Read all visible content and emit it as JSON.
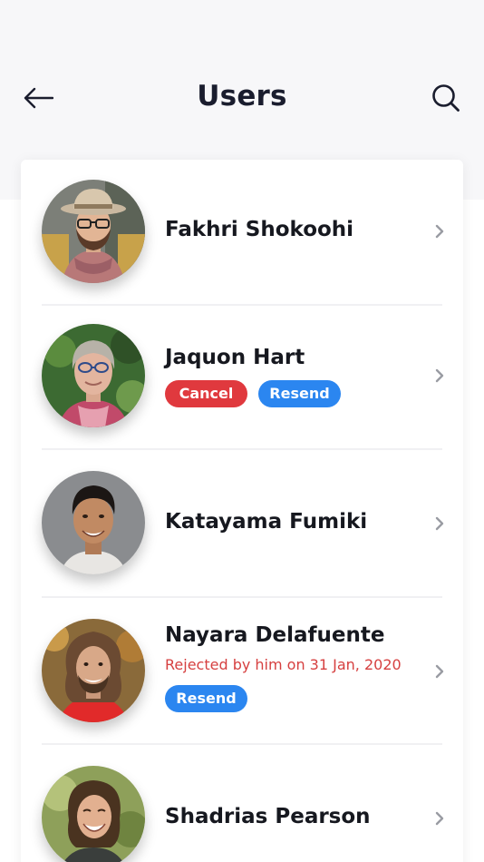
{
  "header": {
    "title": "Users",
    "back_icon": "arrow-left-icon",
    "search_icon": "search-icon"
  },
  "colors": {
    "header_background": "#f7f7f9",
    "cancel": "#e0393e",
    "resend": "#2b86f0",
    "rejected_text": "#d64040",
    "name_text": "#16181f"
  },
  "users": [
    {
      "name": "Fakhri Shokoohi"
    },
    {
      "name": "Jaquon Hart",
      "cancel_label": "Cancel",
      "resend_label": "Resend"
    },
    {
      "name": "Katayama Fumiki"
    },
    {
      "name": "Nayara Delafuente",
      "status": "Rejected by him on 31 Jan, 2020",
      "resend_label": "Resend"
    },
    {
      "name": "Shadrias Pearson"
    }
  ]
}
